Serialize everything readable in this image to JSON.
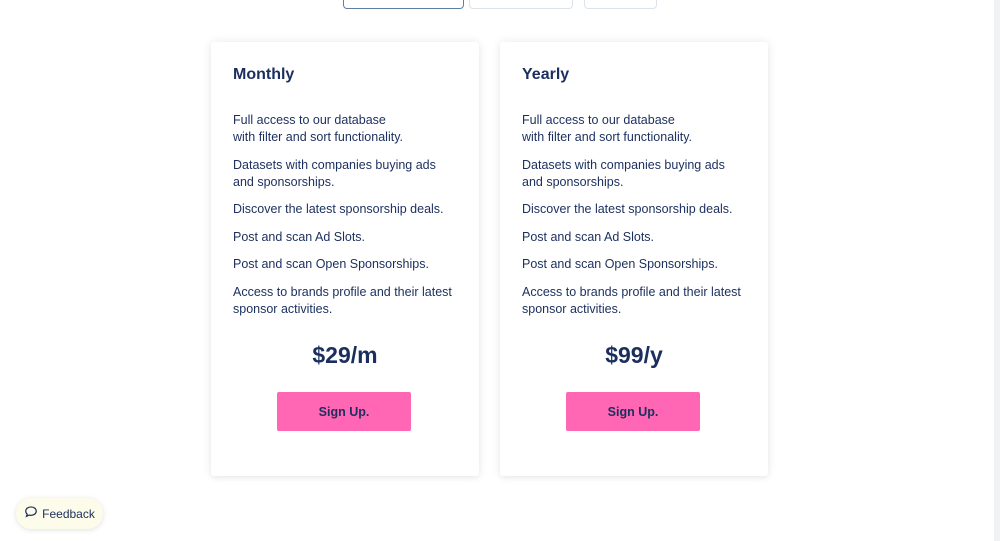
{
  "tabs": [
    {
      "label": "",
      "active": true
    },
    {
      "label": "",
      "active": false
    },
    {
      "label": "",
      "active": false
    }
  ],
  "plans": {
    "monthly": {
      "title": "Monthly",
      "features": [
        "Full access to our database with filter and sort functionality.",
        "Datasets with companies buying ads and sponsorships.",
        "Discover the latest sponsorship deals.",
        "Post and scan Ad Slots.",
        "Post and scan Open Sponsorships.",
        "Access to brands profile and their latest sponsor activities."
      ],
      "price": "$29/m",
      "button_label": "Sign Up."
    },
    "yearly": {
      "title": "Yearly",
      "features": [
        "Full access to our database with filter and sort functionality.",
        "Datasets with companies buying ads and sponsorships.",
        "Discover the latest sponsorship deals.",
        "Post and scan Ad Slots.",
        "Post and scan Open Sponsorships.",
        "Access to brands profile and their latest sponsor activities."
      ],
      "price": "$99/y",
      "button_label": "Sign Up."
    }
  },
  "feedback": {
    "label": "Feedback",
    "icon": "speech-bubble-icon"
  },
  "colors": {
    "text": "#1b2f5e",
    "button": "#ff66b3",
    "active_tab_border": "#5d7fa6",
    "feedback_bg": "#fdfbe9"
  }
}
